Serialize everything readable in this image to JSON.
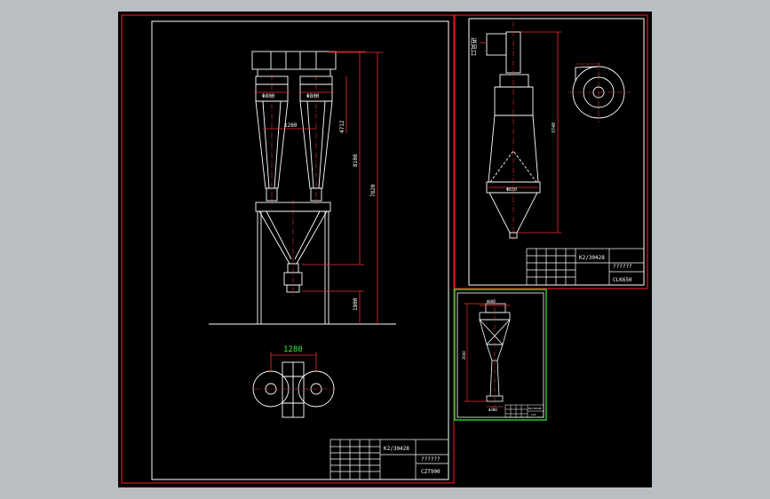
{
  "colors": {
    "background": "#b9bec3",
    "paper": "#000000",
    "frame": "#e0161e",
    "line": "#ffffff",
    "dimension": "#f03030",
    "centerline": "#ff4040",
    "annotation": "#3cf03c"
  },
  "sheet_left": {
    "dimensions": {
      "dia_left": "Φ800",
      "dia_right": "Φ800",
      "span": "1280",
      "height_upper": "4712",
      "height_mid": "8108",
      "height_total": "7820",
      "height_base": "1800",
      "plan_span": "1280"
    },
    "title_block": {
      "drawing_no": "K2/30428",
      "company": "??????",
      "model": "CZT900"
    }
  },
  "sheet_right_top": {
    "inlet_label": "进风口",
    "dimensions": {
      "height": "3740",
      "cone_dia": "Φ650"
    },
    "title_block": {
      "drawing_no": "K2/30428",
      "company": "??????",
      "model": "CLK650"
    }
  },
  "sheet_right_bottom": {
    "dimensions": {
      "top_dia": "Φ800",
      "height": "2600",
      "bottom_dia": "Φ300"
    },
    "title_block": {
      "drawing_no": "K2/30428",
      "model": "CLK"
    }
  }
}
